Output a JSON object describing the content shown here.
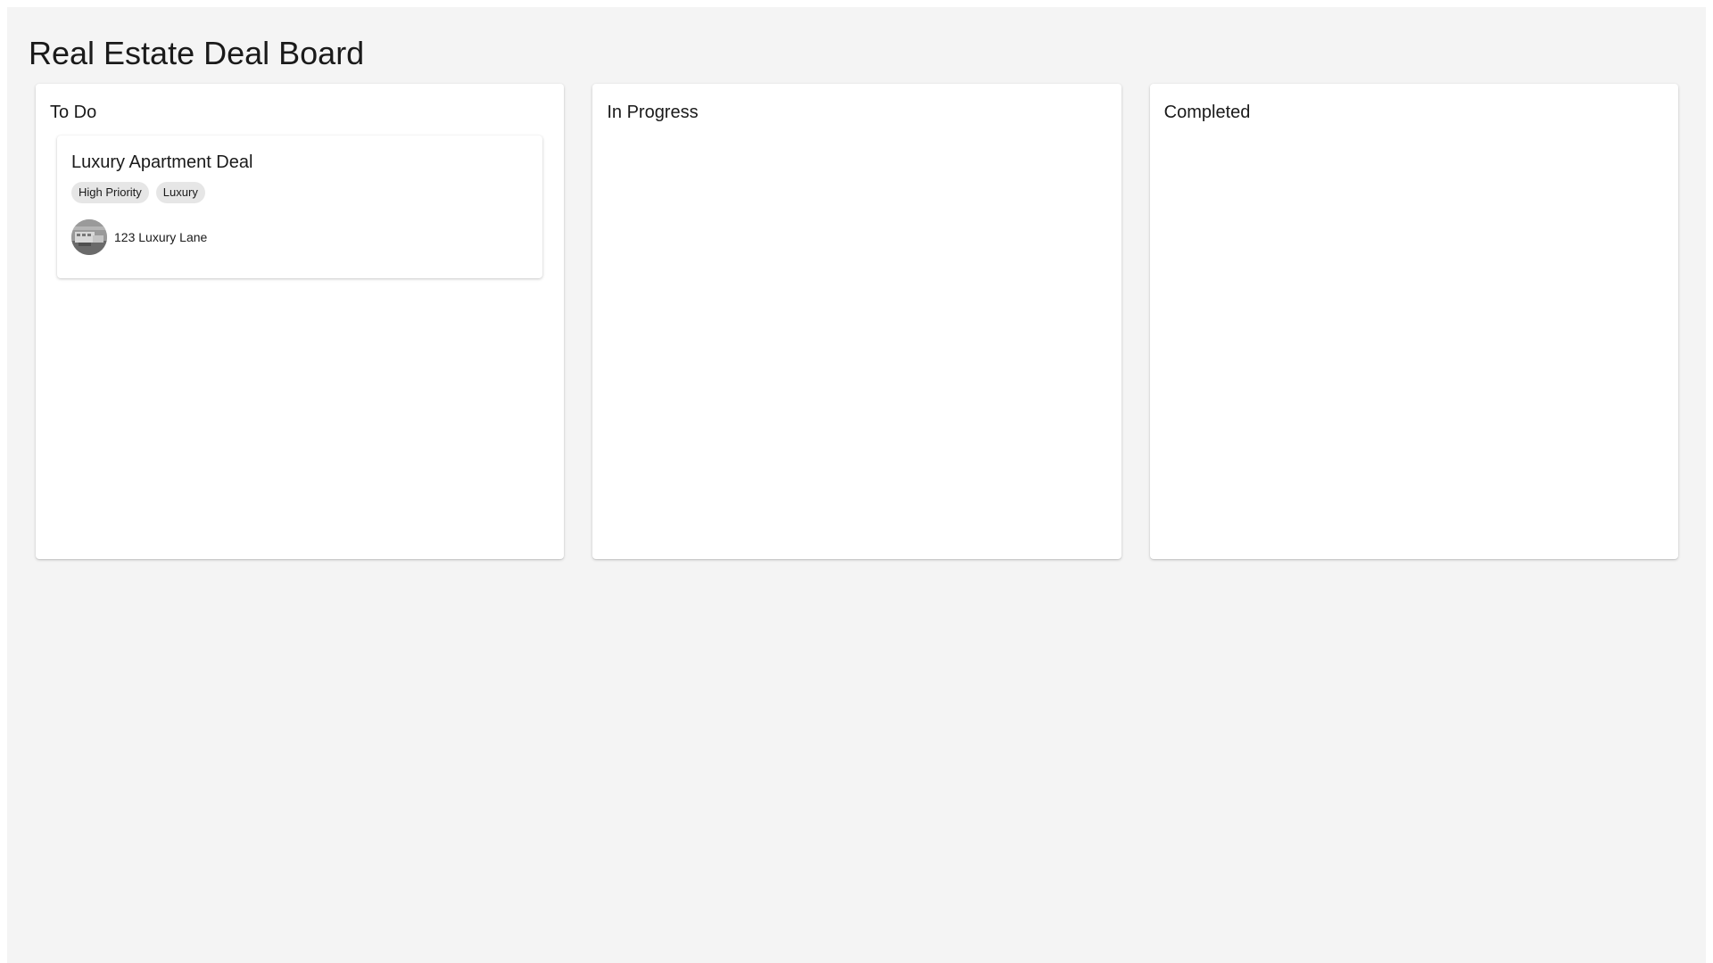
{
  "app": {
    "title": "Real Estate Deal Board"
  },
  "columns": [
    {
      "title": "To Do",
      "cards": [
        {
          "title": "Luxury Apartment Deal",
          "tags": [
            "High Priority",
            "Luxury"
          ],
          "address": "123 Luxury Lane",
          "avatar_icon": "property-photo"
        }
      ]
    },
    {
      "title": "In Progress",
      "cards": []
    },
    {
      "title": "Completed",
      "cards": []
    }
  ],
  "colors": {
    "page_background": "#f4f4f4",
    "column_background": "#ffffff",
    "tag_background": "#e6e6e6",
    "text": "#1a1a1a"
  }
}
